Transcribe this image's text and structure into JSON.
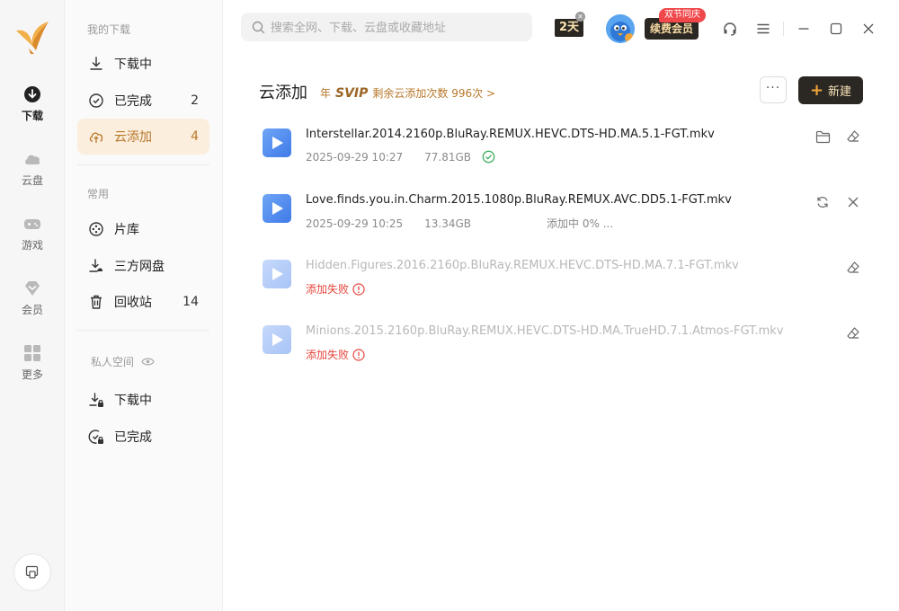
{
  "rail": {
    "items": [
      {
        "label": "下载",
        "icon": "download-circle-icon"
      },
      {
        "label": "云盘",
        "icon": "cloud-icon"
      },
      {
        "label": "游戏",
        "icon": "gamepad-icon"
      },
      {
        "label": "会员",
        "icon": "diamond-icon"
      },
      {
        "label": "更多",
        "icon": "grid-icon"
      }
    ]
  },
  "sidebar": {
    "section_downloads": "我的下载",
    "downloading": "下载中",
    "completed": "已完成",
    "completed_count": "2",
    "cloud_add": "云添加",
    "cloud_add_count": "4",
    "section_common": "常用",
    "library": "片库",
    "third_party": "三方网盘",
    "recycle": "回收站",
    "recycle_count": "14",
    "section_private": "私人空间",
    "private_downloading": "下载中",
    "private_completed": "已完成"
  },
  "topbar": {
    "search_placeholder": "搜索全网、下载、云盘或收藏地址",
    "days_badge": "2天",
    "promo_tag": "双节同庆",
    "renew_label": "续费会员"
  },
  "content": {
    "title": "云添加",
    "vip_prefix": "年",
    "vip_brand": "SVIP",
    "vip_remaining": "剩余云添加次数 996次 >",
    "more_label": "···",
    "new_label": "新建"
  },
  "tasks": [
    {
      "name": "Interstellar.2014.2160p.BluRay.REMUX.HEVC.DTS-HD.MA.5.1-FGT.mkv",
      "date": "2025-09-29 10:27",
      "size": "77.81GB",
      "status": "completed"
    },
    {
      "name": "Love.finds.you.in.Charm.2015.1080p.BluRay.REMUX.AVC.DD5.1-FGT.mkv",
      "date": "2025-09-29 10:25",
      "size": "13.34GB",
      "status": "adding",
      "progress_text": "添加中 0% ..."
    },
    {
      "name": "Hidden.Figures.2016.2160p.BluRay.REMUX.HEVC.DTS-HD.MA.7.1-FGT.mkv",
      "status": "failed",
      "fail_text": "添加失败"
    },
    {
      "name": "Minions.2015.2160p.BluRay.REMUX.HEVC.DTS-HD.MA.TrueHD.7.1.Atmos-FGT.mkv",
      "status": "failed",
      "fail_text": "添加失败"
    }
  ],
  "colors": {
    "accent": "#b7782b",
    "dark": "#2b2723",
    "active_bg": "#fbeedd",
    "fail": "#e8453c",
    "success": "#3fae5d",
    "play": "#3f7ae8"
  }
}
